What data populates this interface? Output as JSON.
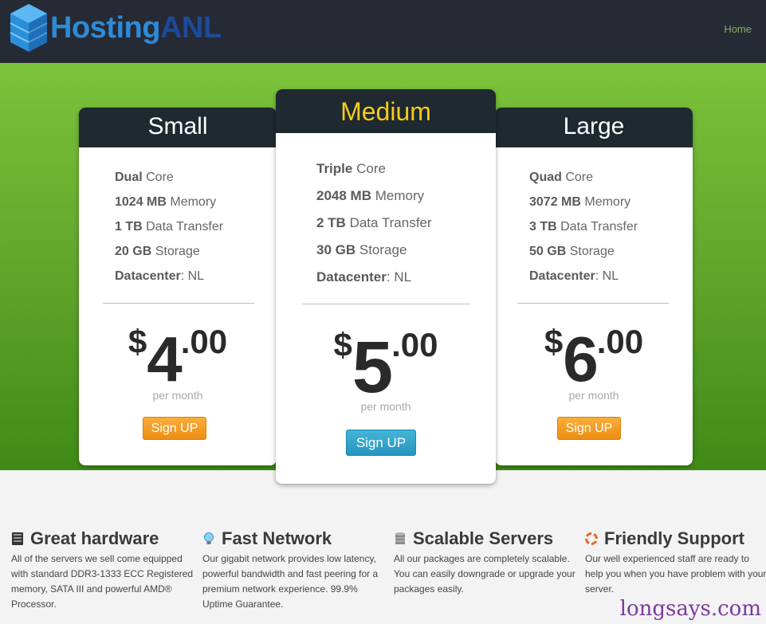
{
  "header": {
    "logo_part1": "Hosting",
    "logo_part2": "ANL",
    "nav_home": "Home"
  },
  "plans": [
    {
      "name": "Small",
      "features": [
        {
          "bold": "Dual",
          "rest": " Core"
        },
        {
          "bold": "1024 MB",
          "rest": " Memory"
        },
        {
          "bold": "1 TB",
          "rest": " Data Transfer"
        },
        {
          "bold": "20 GB",
          "rest": " Storage"
        },
        {
          "bold": "Datacenter",
          "rest": ": NL"
        }
      ],
      "currency": "$",
      "price_int": "4",
      "price_dec": ".00",
      "period": "per month",
      "button": "Sign UP"
    },
    {
      "name": "Medium",
      "features": [
        {
          "bold": "Triple",
          "rest": " Core"
        },
        {
          "bold": "2048 MB",
          "rest": " Memory"
        },
        {
          "bold": "2 TB",
          "rest": " Data Transfer"
        },
        {
          "bold": "30 GB",
          "rest": " Storage"
        },
        {
          "bold": "Datacenter",
          "rest": ": NL"
        }
      ],
      "currency": "$",
      "price_int": "5",
      "price_dec": ".00",
      "period": "per month",
      "button": "Sign UP"
    },
    {
      "name": "Large",
      "features": [
        {
          "bold": "Quad",
          "rest": " Core"
        },
        {
          "bold": "3072 MB",
          "rest": " Memory"
        },
        {
          "bold": "3 TB",
          "rest": " Data Transfer"
        },
        {
          "bold": "50 GB",
          "rest": " Storage"
        },
        {
          "bold": "Datacenter",
          "rest": ": NL"
        }
      ],
      "currency": "$",
      "price_int": "6",
      "price_dec": ".00",
      "period": "per month",
      "button": "Sign UP"
    }
  ],
  "features": [
    {
      "icon": "server-icon",
      "title": "Great hardware",
      "text": "All of the servers we sell come equipped with standard DDR3-1333 ECC Registered memory, SATA III and powerful AMD® Processor."
    },
    {
      "icon": "lightbulb-icon",
      "title": "Fast Network",
      "text": "Our gigabit network provides low latency, powerful bandwidth and fast peering for a premium network experience. 99.9% Uptime Guarantee."
    },
    {
      "icon": "database-icon",
      "title": "Scalable Servers",
      "text": "All our packages are completely scalable. You can easily downgrade or upgrade your packages easily."
    },
    {
      "icon": "lifebuoy-icon",
      "title": "Friendly Support",
      "text": "Our well experienced staff are ready to help you when you have problem with your server."
    }
  ],
  "watermark": "longsays.com",
  "colors": {
    "header_bg": "#262a35",
    "hero_green": "#5ea32a",
    "plan_head_bg": "#1e2930",
    "medium_title": "#f6cc1b",
    "orange_button": "#ec8d13",
    "blue_button": "#2796bf"
  }
}
